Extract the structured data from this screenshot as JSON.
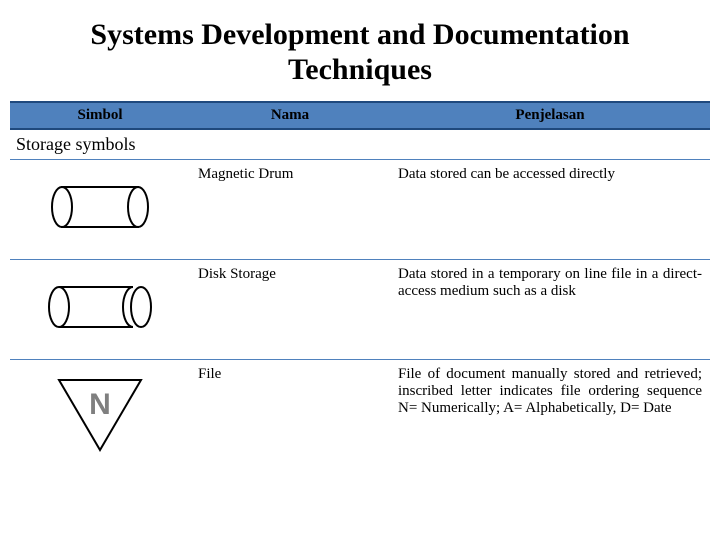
{
  "title": "Systems Development and Documentation Techniques",
  "headers": {
    "simbol": "Simbol",
    "nama": "Nama",
    "penjelasan": "Penjelasan"
  },
  "section_label": "Storage symbols",
  "rows": [
    {
      "nama": "Magnetic Drum",
      "penjelasan": "Data stored can be accessed directly"
    },
    {
      "nama": "Disk Storage",
      "penjelasan": "Data stored in a temporary on line file in a direct-access medium such as a disk"
    },
    {
      "nama": "File",
      "penjelasan": "File of document manually stored and retrieved; inscribed letter indicates file ordering sequence N= Numerically; A= Alphabetically, D= Date",
      "letter": "N"
    }
  ]
}
